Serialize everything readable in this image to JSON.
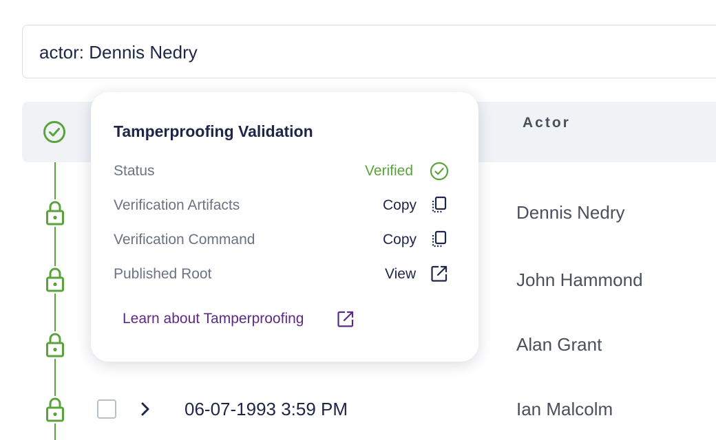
{
  "search": {
    "query": "actor: Dennis Nedry"
  },
  "table": {
    "header": {
      "actor_label": "Actor"
    },
    "rows": [
      {
        "actor": "Dennis Nedry"
      },
      {
        "actor": "John Hammond"
      },
      {
        "actor": "Alan Grant"
      },
      {
        "date": "06-07-1993 3:59 PM",
        "actor": "Ian Malcolm"
      }
    ]
  },
  "popover": {
    "title": "Tamperproofing Validation",
    "status_label": "Status",
    "status_value": "Verified",
    "artifacts_label": "Verification Artifacts",
    "artifacts_action": "Copy",
    "command_label": "Verification Command",
    "command_action": "Copy",
    "root_label": "Published Root",
    "root_action": "View",
    "learn_link": "Learn about Tamperproofing"
  },
  "icons": {
    "verified": "check-circle-icon",
    "lock": "lock-icon",
    "copy": "copy-icon",
    "external": "external-link-icon",
    "chevron": "chevron-right-icon"
  },
  "colors": {
    "accent_green": "#5aa33a",
    "link_purple": "#5b2a86",
    "text_dark": "#1f2547",
    "text_muted": "#6b7280",
    "header_bg": "#f0f3f6"
  }
}
